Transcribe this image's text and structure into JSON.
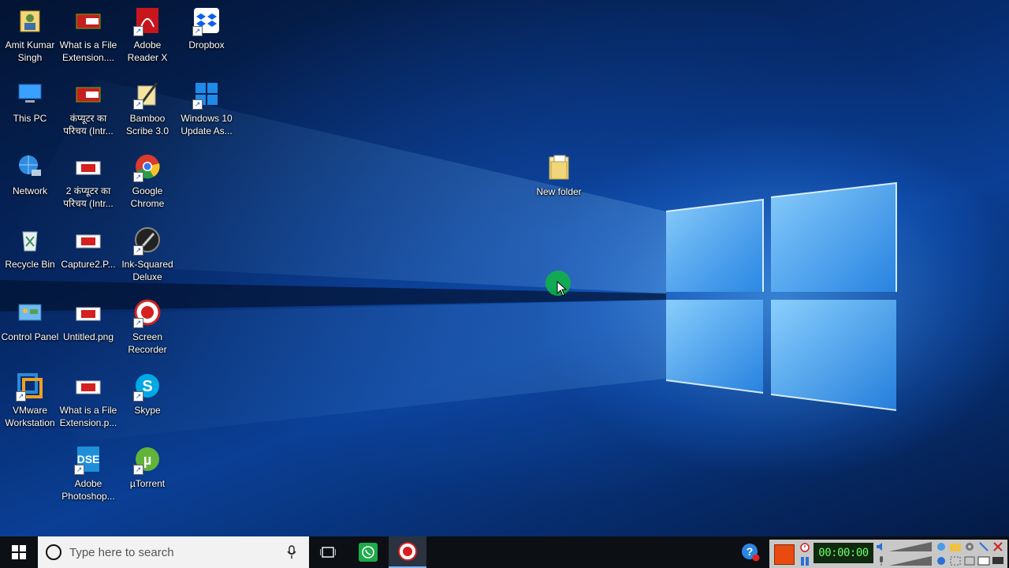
{
  "desktop": {
    "icons": [
      {
        "label": "Amit Kumar Singh",
        "icon": "user-folder-icon",
        "col": 0,
        "row": 0
      },
      {
        "label": "This PC",
        "icon": "computer-icon",
        "col": 0,
        "row": 1
      },
      {
        "label": "Network",
        "icon": "network-icon",
        "col": 0,
        "row": 2
      },
      {
        "label": "Recycle Bin",
        "icon": "recycle-bin-icon",
        "col": 0,
        "row": 3
      },
      {
        "label": "Control Panel",
        "icon": "control-panel-icon",
        "col": 0,
        "row": 4
      },
      {
        "label": "VMware Workstation",
        "icon": "vmware-icon",
        "col": 0,
        "row": 5
      },
      {
        "label": "What is a File Extension....",
        "icon": "video-file-icon",
        "col": 1,
        "row": 0
      },
      {
        "label": "कंप्यूटर का परिचय (Intr...",
        "icon": "video-file-icon",
        "col": 1,
        "row": 1
      },
      {
        "label": "2 कंप्यूटर का परिचय (Intr...",
        "icon": "image-file-icon",
        "col": 1,
        "row": 2
      },
      {
        "label": "Capture2.P...",
        "icon": "image-file-icon",
        "col": 1,
        "row": 3
      },
      {
        "label": "Untitled.png",
        "icon": "image-file-icon",
        "col": 1,
        "row": 4
      },
      {
        "label": "What is a File Extension.p...",
        "icon": "image-file-icon",
        "col": 1,
        "row": 5
      },
      {
        "label": "Adobe Photoshop...",
        "icon": "photoshop-icon",
        "col": 1,
        "row": 6
      },
      {
        "label": "Adobe Reader X",
        "icon": "adobe-reader-icon",
        "col": 2,
        "row": 0
      },
      {
        "label": "Bamboo Scribe 3.0",
        "icon": "bamboo-scribe-icon",
        "col": 2,
        "row": 1
      },
      {
        "label": "Google Chrome",
        "icon": "chrome-icon",
        "col": 2,
        "row": 2
      },
      {
        "label": "Ink-Squared Deluxe",
        "icon": "ink-squared-icon",
        "col": 2,
        "row": 3
      },
      {
        "label": "Screen Recorder",
        "icon": "screen-recorder-icon",
        "col": 2,
        "row": 4
      },
      {
        "label": "Skype",
        "icon": "skype-icon",
        "col": 2,
        "row": 5
      },
      {
        "label": "µTorrent",
        "icon": "utorrent-icon",
        "col": 2,
        "row": 6
      },
      {
        "label": "Dropbox",
        "icon": "dropbox-icon",
        "col": 3,
        "row": 0
      },
      {
        "label": "Windows 10 Update As...",
        "icon": "windows-update-icon",
        "col": 3,
        "row": 1
      }
    ],
    "new_folder": {
      "label": "New folder",
      "icon": "folder-icon"
    }
  },
  "taskbar": {
    "search_placeholder": "Type here to search",
    "pinned": [
      {
        "name": "task-view-icon"
      },
      {
        "name": "whatsapp-icon"
      },
      {
        "name": "screen-recorder-icon",
        "active": true
      }
    ]
  },
  "recorder": {
    "timer": "00:00:00"
  },
  "colors": {
    "taskbar": "#0c0f14",
    "accent": "#1a78d6",
    "recording": "#e84a10",
    "timer_text": "#6dff6d"
  }
}
